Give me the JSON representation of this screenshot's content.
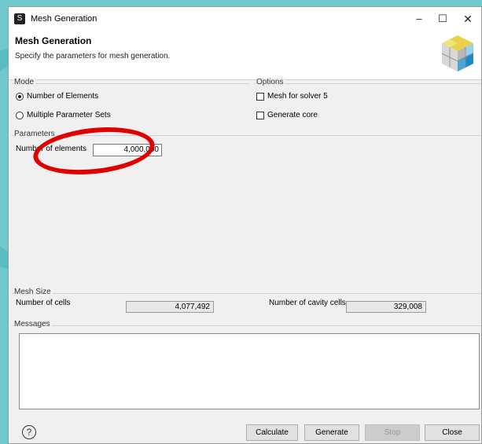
{
  "window": {
    "title": "Mesh Generation"
  },
  "window_controls": {
    "minimize": "–",
    "maximize": "☐",
    "close": "✕"
  },
  "header": {
    "title": "Mesh Generation",
    "description": "Specify the parameters for mesh generation."
  },
  "mode": {
    "label": "Mode",
    "options": [
      {
        "label": "Number of Elements",
        "selected": true
      },
      {
        "label": "Multiple Parameter Sets",
        "selected": false
      }
    ]
  },
  "options": {
    "label": "Options",
    "checks": [
      {
        "label": "Mesh for solver 5",
        "checked": false
      },
      {
        "label": "Generate core",
        "checked": false
      }
    ]
  },
  "parameters": {
    "label": "Parameters",
    "num_elements_label": "Number of elements",
    "num_elements_value": "4,000,000"
  },
  "mesh_size": {
    "label": "Mesh Size",
    "cells_label": "Number of cells",
    "cells_value": "4,077,492",
    "cavity_label": "Number of cavity cells",
    "cavity_value": "329,008"
  },
  "messages": {
    "label": "Messages",
    "content": ""
  },
  "buttons": {
    "help": "?",
    "calculate": "Calculate",
    "generate": "Generate",
    "stop": "Stop",
    "close": "Close"
  },
  "colors": {
    "annotation": "#e00000",
    "background": "#6fc8cc"
  }
}
